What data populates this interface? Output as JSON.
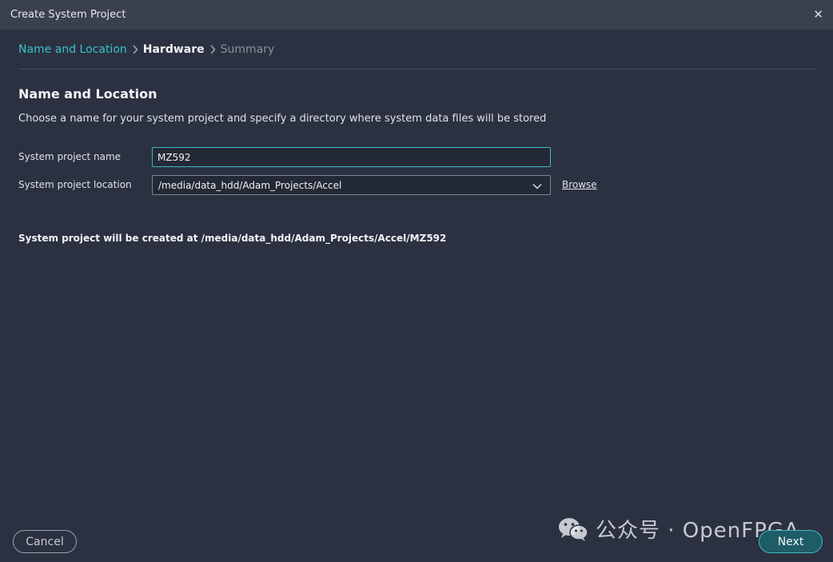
{
  "window": {
    "title": "Create System Project",
    "close_icon": "close-icon"
  },
  "breadcrumb": {
    "steps": [
      {
        "label": "Name and Location",
        "state": "active"
      },
      {
        "label": "Hardware",
        "state": "current"
      },
      {
        "label": "Summary",
        "state": "future"
      }
    ]
  },
  "section": {
    "title": "Name and Location",
    "description": "Choose a name for your system project and specify a directory where system data files will be stored"
  },
  "form": {
    "name_label": "System project name",
    "name_value": "MZ592",
    "location_label": "System project location",
    "location_value": "/media/data_hdd/Adam_Projects/Accel",
    "browse_label": "Browse"
  },
  "created_at": "System project will be created at /media/data_hdd/Adam_Projects/Accel/MZ592",
  "buttons": {
    "cancel": "Cancel",
    "next": "Next"
  },
  "watermark": {
    "text": "公众号 · OpenFPGA",
    "icon": "wechat-icon"
  },
  "colors": {
    "accent": "#3ec0cc",
    "background": "#2b3140",
    "titlebar": "#3a404e"
  }
}
